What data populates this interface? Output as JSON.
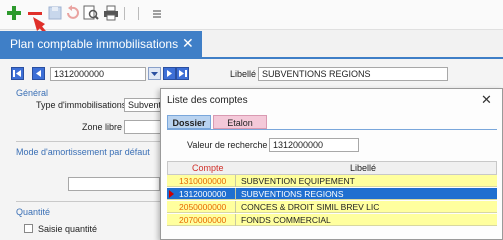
{
  "colors": {
    "accent": "#3f7fc7",
    "add_icon": "#2e9a2e",
    "remove_icon": "#e0302a",
    "arrow": "#e0302a",
    "row_highlight": "#ffff9e",
    "row_selected": "#1f6fd0",
    "code_text": "#e86a00"
  },
  "toolbar": {
    "icons": [
      "plus-icon",
      "minus-icon",
      "save-icon",
      "undo-icon",
      "preview-icon",
      "print-icon",
      "menu-icon"
    ]
  },
  "tab": {
    "label": "Plan comptable immobilisations",
    "close": "✕"
  },
  "record": {
    "code": "1312000000",
    "libelle_label": "Libellé",
    "libelle_value": "SUBVENTIONS REGIONS"
  },
  "general": {
    "section_title": "Général",
    "type_label": "Type d'immobilisations",
    "type_value": "Subvent",
    "zone_label": "Zone libre"
  },
  "amortissement": {
    "section_title": "Mode d'amortissement par défaut"
  },
  "quantite": {
    "section_title": "Quantité",
    "checkbox_label": "Saisie quantité"
  },
  "dialog": {
    "title": "Liste des comptes",
    "close": "✕",
    "tabs": [
      "Dossier",
      "Etalon"
    ],
    "search_label": "Valeur de recherche",
    "search_value": "1312000000",
    "columns": [
      "Compte",
      "Libellé"
    ],
    "rows": [
      {
        "compte": "1310000000",
        "libelle": "SUBVENTION EQUIPEMENT",
        "selected": false
      },
      {
        "compte": "1312000000",
        "libelle": "SUBVENTIONS REGIONS",
        "selected": true
      },
      {
        "compte": "2050000000",
        "libelle": "CONCES & DROIT SIMIL BREV LIC",
        "selected": false
      },
      {
        "compte": "2070000000",
        "libelle": "FONDS COMMERCIAL",
        "selected": false
      }
    ]
  }
}
